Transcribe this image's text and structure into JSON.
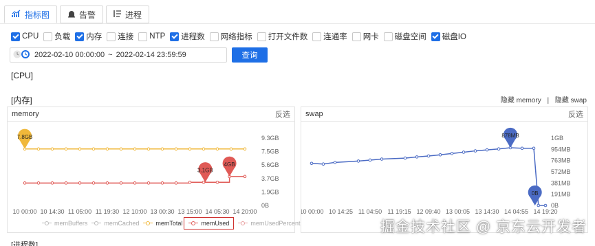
{
  "tabs": [
    {
      "label": "指标图",
      "icon": "bar-chart-icon",
      "active": true
    },
    {
      "label": "告警",
      "icon": "alarm-icon",
      "active": false
    },
    {
      "label": "进程",
      "icon": "list-icon",
      "active": false
    }
  ],
  "metrics": [
    {
      "label": "CPU",
      "checked": true
    },
    {
      "label": "负载",
      "checked": false
    },
    {
      "label": "内存",
      "checked": true
    },
    {
      "label": "连接",
      "checked": false
    },
    {
      "label": "NTP",
      "checked": false
    },
    {
      "label": "进程数",
      "checked": true
    },
    {
      "label": "网络指标",
      "checked": false
    },
    {
      "label": "打开文件数",
      "checked": false
    },
    {
      "label": "连通率",
      "checked": false
    },
    {
      "label": "网卡",
      "checked": false
    },
    {
      "label": "磁盘空间",
      "checked": false
    },
    {
      "label": "磁盘IO",
      "checked": true
    }
  ],
  "date_range": {
    "start": "2022-02-10 00:00:00",
    "separator": "~",
    "end": "2022-02-14 23:59:59"
  },
  "query_label": "查询",
  "sections": {
    "cpu": "[CPU]",
    "memory": "[内存]",
    "process": "[进程数]"
  },
  "toggles": {
    "hide_memory": "隐藏 memory",
    "divider": "|",
    "hide_swap": "隐藏 swap"
  },
  "panels": {
    "memory": {
      "title": "memory",
      "invert": "反选"
    },
    "swap": {
      "title": "swap",
      "invert": "反选"
    }
  },
  "watermark": "掘金技术社区 @ 京东云开发者",
  "colors": {
    "accent": "#1e6fe6",
    "memTotal": "#f0b83a",
    "memUsed": "#e05a56",
    "swap": "#4b6bc4",
    "legendBox": "#d0322f"
  },
  "chart_data": [
    {
      "type": "line",
      "title": "memory",
      "x": [
        "10 00:00",
        "10 14:30",
        "11 05:00",
        "11 19:30",
        "12 10:00",
        "13 00:30",
        "13 15:00",
        "14 05:30",
        "14 20:00"
      ],
      "y_ticks": [
        "0B",
        "1.9GB",
        "3.7GB",
        "5.6GB",
        "7.5GB",
        "9.3GB"
      ],
      "ylim_gb": [
        0,
        9.3
      ],
      "series": [
        {
          "name": "memBuffers",
          "values": []
        },
        {
          "name": "memCached",
          "values": []
        },
        {
          "name": "memTotal",
          "values_gb": [
            7.8,
            7.8,
            7.8,
            7.8,
            7.8,
            7.8,
            7.8,
            7.8,
            7.8,
            7.8,
            7.8,
            7.8,
            7.8,
            7.8,
            7.8,
            7.8,
            7.8
          ],
          "x_frac": [
            0,
            0.0625,
            0.125,
            0.1875,
            0.25,
            0.3125,
            0.375,
            0.4375,
            0.5,
            0.5625,
            0.625,
            0.6875,
            0.75,
            0.8125,
            0.875,
            0.9375,
            1
          ]
        },
        {
          "name": "memUsed",
          "values_gb": [
            3.1,
            3.1,
            3.1,
            3.1,
            3.1,
            3.1,
            3.1,
            3.1,
            3.1,
            3.1,
            3.1,
            3.1,
            3.2,
            3.2,
            3.2,
            4.0,
            4.0
          ],
          "x_frac": [
            0,
            0.0625,
            0.125,
            0.1875,
            0.25,
            0.3125,
            0.375,
            0.4375,
            0.5,
            0.5625,
            0.625,
            0.6875,
            0.75,
            0.8125,
            0.875,
            0.93,
            1
          ]
        },
        {
          "name": "memUsedPercent",
          "values": []
        }
      ],
      "markers": [
        {
          "series": "memTotal",
          "label": "7.8GB",
          "value_gb": 7.8,
          "x_frac": 0
        },
        {
          "series": "memUsed",
          "label": "3.1GB",
          "value_gb": 3.2,
          "x_frac": 0.82
        },
        {
          "series": "memUsed",
          "label": "4GB",
          "value_gb": 4.0,
          "x_frac": 0.93
        }
      ],
      "legend": [
        "memBuffers",
        "memCached",
        "memTotal",
        "memUsed",
        "memUsedPercent"
      ]
    },
    {
      "type": "line",
      "title": "swap",
      "x": [
        "10 00:00",
        "10 14:25",
        "11 04:50",
        "11 19:15",
        "12 09:40",
        "13 00:05",
        "13 14:30",
        "14 04:55",
        "14 19:20"
      ],
      "y_ticks": [
        "0B",
        "191MB",
        "381MB",
        "572MB",
        "763MB",
        "954MB",
        "1GB"
      ],
      "ylim_mb": [
        0,
        1024
      ],
      "series": [
        {
          "name": "swap",
          "values_mb": [
            640,
            630,
            655,
            675,
            690,
            705,
            720,
            738,
            752,
            770,
            790,
            810,
            830,
            845,
            860,
            878,
            870,
            870,
            0,
            0
          ],
          "x_frac": [
            0,
            0.05,
            0.1,
            0.2,
            0.25,
            0.3,
            0.4,
            0.45,
            0.5,
            0.55,
            0.6,
            0.65,
            0.7,
            0.75,
            0.8,
            0.85,
            0.9,
            0.95,
            0.97,
            1
          ]
        }
      ],
      "markers": [
        {
          "label": "878MB",
          "value_mb": 878,
          "x_frac": 0.85
        },
        {
          "label": "0B",
          "value_mb": 0,
          "x_frac": 0.955
        }
      ]
    }
  ]
}
